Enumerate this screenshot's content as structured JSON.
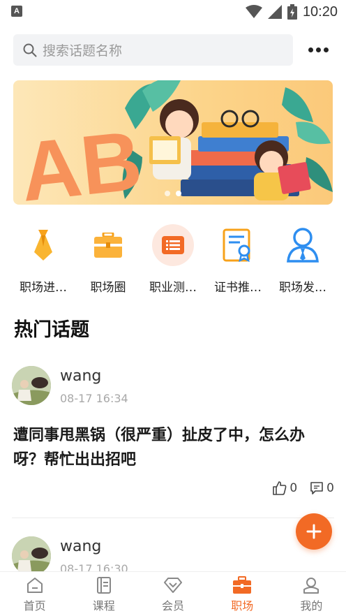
{
  "status_bar": {
    "app_icon_letter": "A",
    "time": "10:20"
  },
  "search": {
    "placeholder": "搜索话题名称"
  },
  "banner": {
    "letters": "AB",
    "page_count": 2,
    "active_index": 1
  },
  "categories": [
    {
      "label": "职场进…",
      "icon": "tie-icon"
    },
    {
      "label": "职场圈",
      "icon": "briefcase-icon"
    },
    {
      "label": "职业测…",
      "icon": "list-icon"
    },
    {
      "label": "证书推…",
      "icon": "certificate-icon"
    },
    {
      "label": "职场发…",
      "icon": "person-icon"
    }
  ],
  "section_title": "热门话题",
  "posts": [
    {
      "username": "wang",
      "time": "08-17 16:34",
      "title": "遭同事甩黑锅（很严重）扯皮了中，怎么办呀？帮忙出出招吧",
      "likes": "0",
      "comments": "0"
    },
    {
      "username": "wang",
      "time": "08-17 16:30"
    }
  ],
  "tabs": [
    {
      "label": "首页",
      "icon": "home-icon",
      "active": false
    },
    {
      "label": "课程",
      "icon": "course-icon",
      "active": false
    },
    {
      "label": "会员",
      "icon": "vip-icon",
      "active": false
    },
    {
      "label": "职场",
      "icon": "workplace-icon",
      "active": true
    },
    {
      "label": "我的",
      "icon": "profile-icon",
      "active": false
    }
  ],
  "colors": {
    "accent": "#f26a25",
    "category_orange": "#f7a21b",
    "category_blue": "#2e8ef0"
  }
}
